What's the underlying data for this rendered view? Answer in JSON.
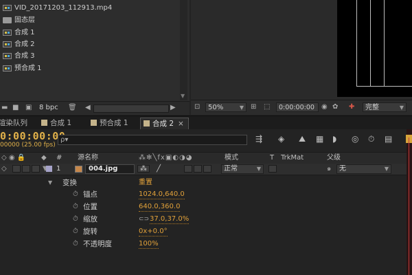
{
  "project": {
    "items": [
      {
        "label": "VID_20171203_112913.mp4",
        "icon": "video-file-icon"
      },
      {
        "label": "固态层",
        "icon": "folder-icon"
      },
      {
        "label": "合成 1",
        "icon": "composition-icon"
      },
      {
        "label": "合成 2",
        "icon": "composition-icon"
      },
      {
        "label": "合成 3",
        "icon": "composition-icon"
      },
      {
        "label": "预合成 1",
        "icon": "composition-icon"
      }
    ],
    "bpc": "8 bpc"
  },
  "viewer": {
    "zoom": "50%",
    "timecode": "0:00:00:00",
    "resolution": "完整"
  },
  "tabs": [
    {
      "label": "渲染队列",
      "active": false
    },
    {
      "label": "合成 1",
      "active": false
    },
    {
      "label": "预合成 1",
      "active": false
    },
    {
      "label": "合成 2",
      "active": true
    }
  ],
  "timeline": {
    "timecode": "0:00:00:00",
    "fps": "00000 (25.00 fps)",
    "search_placeholder": "ρ▾",
    "headers": {
      "hash": "#",
      "source_name": "源名称",
      "mode": "模式",
      "t": "T",
      "trkmat": "TrkMat",
      "parent": "父级"
    },
    "layer": {
      "index": "1",
      "name": "004.jpg",
      "mode": "正常",
      "parent": "无"
    },
    "transform": {
      "label": "变换",
      "reset": "重置",
      "properties": [
        {
          "label": "锚点",
          "value": "1024.0,640.0"
        },
        {
          "label": "位置",
          "value": "640.0,360.0"
        },
        {
          "label": "缩放",
          "value": "37.0,37.0%"
        },
        {
          "label": "旋转",
          "value": "0x+0.0°"
        },
        {
          "label": "不透明度",
          "value": "100%"
        }
      ]
    }
  },
  "colors": {
    "accent_timecode": "#e1b14a",
    "value_orange": "#e1a13a",
    "playhead": "#c43a3a"
  }
}
